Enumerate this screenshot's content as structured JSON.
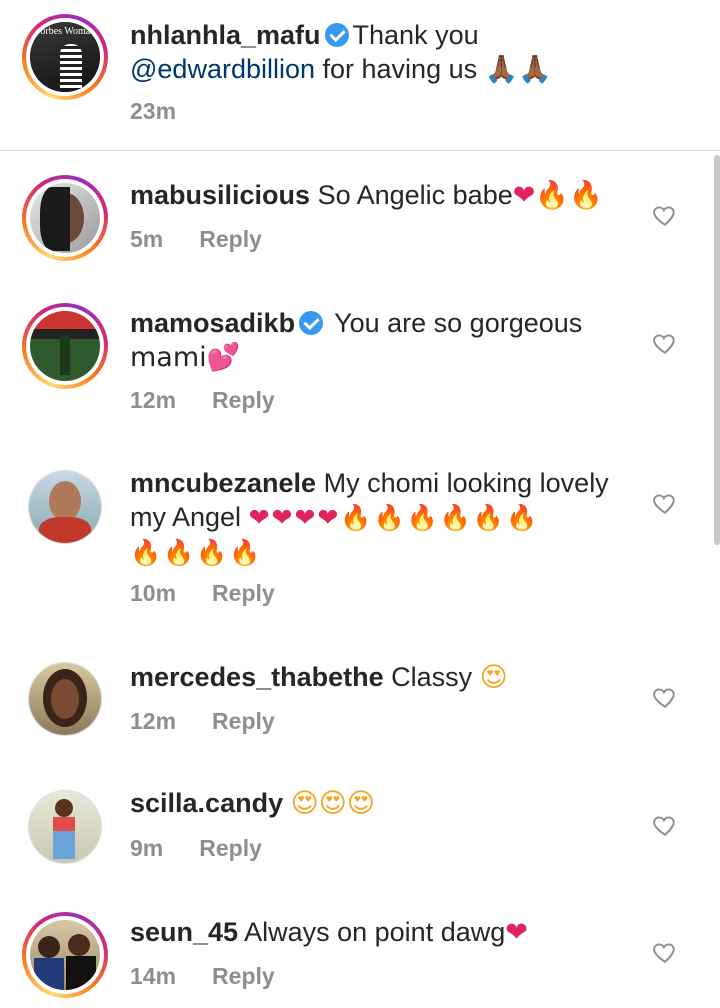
{
  "caption": {
    "username": "nhlanhla_mafu",
    "verified": true,
    "text": "Thank you",
    "mention": "@edwardbillion",
    "text_after": " for having us 🙏🏾🙏🏾",
    "time": "23m",
    "avatar_text": "Forbes Woman"
  },
  "comments": [
    {
      "username": "mabusilicious",
      "text": "So Angelic babe",
      "emoji": "❤🔥🔥",
      "time": "5m",
      "reply": "Reply"
    },
    {
      "username": "mamosadikb",
      "verified": true,
      "text": "You are so gorgeous",
      "text2": "mami💕",
      "time": "12m",
      "reply": "Reply"
    },
    {
      "username": "mncubezanele",
      "text": "My chomi looking lovely",
      "text2": "my Angel",
      "emoji": "❤❤❤❤🔥🔥🔥🔥🔥🔥",
      "emoji2": "🔥🔥🔥🔥",
      "time": "10m",
      "reply": "Reply"
    },
    {
      "username": "mercedes_thabethe",
      "text": "Classy",
      "emoji": "😍",
      "time": "12m",
      "reply": "Reply"
    },
    {
      "username": "scilla.candy",
      "text": "",
      "emoji": "😍😍😍",
      "time": "9m",
      "reply": "Reply"
    },
    {
      "username": "seun_45",
      "text": "Always on point dawg",
      "emoji": "❤",
      "time": "14m",
      "reply": "Reply"
    }
  ],
  "colors": {
    "link": "#00376b",
    "muted": "#8e8e8e",
    "verified": "#3897f0"
  },
  "icons": {
    "like": "heart-outline-icon",
    "verified": "verified-badge-icon"
  }
}
